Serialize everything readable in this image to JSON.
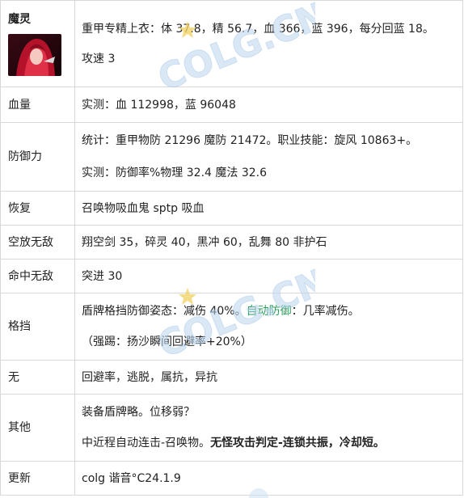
{
  "rows": {
    "hero": {
      "name": "魔灵",
      "line1": "重甲专精上衣：体 37.8，精 56.7，血 366，蓝 396，每分回蓝 18。",
      "line2": "攻速 3"
    },
    "hp": {
      "label": "血量",
      "text": "实测：血 112998，蓝 96048"
    },
    "defense": {
      "label": "防御力",
      "line1": "统计：重甲物防 21296 魔防 21472。职业技能：旋风 10863+。",
      "line2": "实测：防御率%物理 32.4 魔法 32.6"
    },
    "recover": {
      "label": "恢复",
      "text": "召唤物吸血鬼 sptp 吸血"
    },
    "air": {
      "label": "空放无敌",
      "text": "翔空剑 35，碎灵 40，黑冲 60，乱舞 80 非护石"
    },
    "hit": {
      "label": "命中无敌",
      "text": "突进 30"
    },
    "block": {
      "label": "格挡",
      "part1": "盾牌格挡防御姿态：减伤 40%。",
      "green": "自动防御",
      "part2": "：几率减伤。",
      "line2": "（强踢：扬沙瞬间回避率+20%）"
    },
    "none": {
      "label": "无",
      "text": "回避率，逃脱，属抗，异抗"
    },
    "other": {
      "label": "其他",
      "line1": "装备盾牌略。位移弱？",
      "line2_plain": "中近程自动连击-召唤物。",
      "line2_bold": "无怪攻击判定-连锁共振，冷却短。"
    },
    "update": {
      "label": "更新",
      "text": "colg 谐音°C24.1.9"
    }
  },
  "watermark": {
    "text": "COLG.CN"
  },
  "colors": {
    "green": "#2e9e5a",
    "border": "#d8d8d8"
  }
}
